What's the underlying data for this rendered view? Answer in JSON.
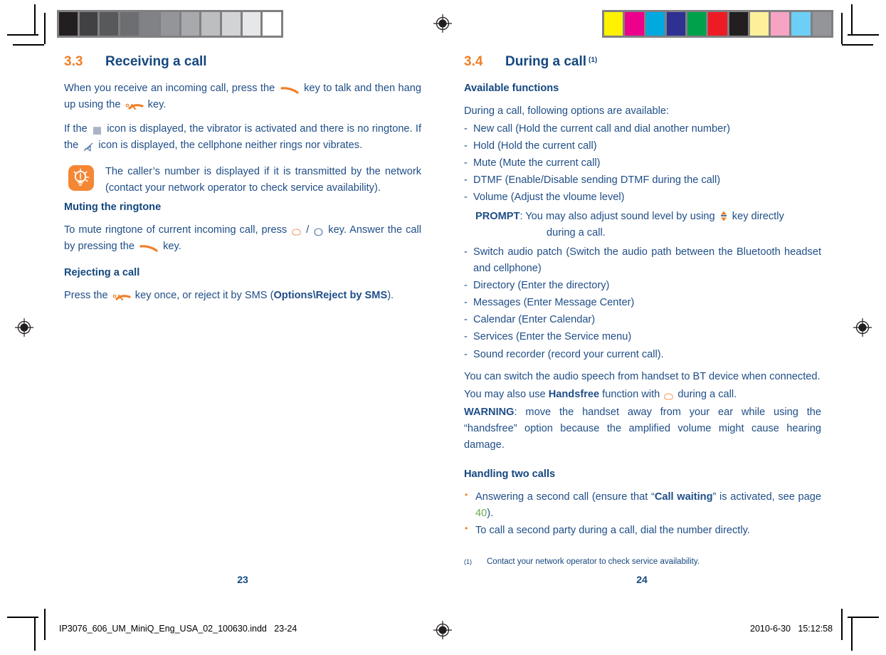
{
  "document": {
    "imprint_left": "IP3076_606_UM_MiniQ_Eng_USA_02_100630.indd   23-24",
    "imprint_right": "2010-6-30   15:12:58"
  },
  "calibration": {
    "grayscale_label": "grayscale-calibration-strip",
    "grayscale_swatches": [
      "#231f20",
      "#414042",
      "#58595b",
      "#6d6e71",
      "#808285",
      "#939598",
      "#a7a9ac",
      "#bcbec0",
      "#d1d3d4",
      "#e6e7e8",
      "#ffffff"
    ],
    "color_label": "color-calibration-strip",
    "color_swatches": [
      "#fff200",
      "#ec008c",
      "#00a9e0",
      "#2e3192",
      "#00a14b",
      "#ed1c24",
      "#231f20",
      "#fdf09a",
      "#f6a3c4",
      "#6dcff6",
      "#939598"
    ]
  },
  "left_page": {
    "section_number": "3.3",
    "section_title": "Receiving a call",
    "para_1_a": "When you receive an incoming call, press the",
    "para_1_b": "key to talk and then hang up using the",
    "para_1_c": "key.",
    "para_2_a": "If the",
    "para_2_b": "icon is displayed, the vibrator is activated and there is no ringtone. If the",
    "para_2_c": "icon is displayed, the cellphone neither rings nor vibrates.",
    "tip_text": "The caller’s number is displayed if it is transmitted by the network (contact your network operator to check service availability).",
    "subtitle_mute": "Muting the ringtone",
    "mute_a": "To mute ringtone of current incoming call, press",
    "mute_slash": "/",
    "mute_b": "key. Answer the call by pressing the",
    "mute_c": "key.",
    "subtitle_reject": "Rejecting a call",
    "reject_a": "Press the",
    "reject_b": "key once, or reject it by SMS (",
    "reject_bold": "Options\\Reject by SMS",
    "reject_c": ").",
    "page_number": "23"
  },
  "right_page": {
    "section_number": "3.4",
    "section_title": "During a call",
    "section_footnote_mark": "(1)",
    "subtitle_available": "Available functions",
    "intro": "During a call, following options are available:",
    "options": [
      "New call (Hold the current call and dial another number)",
      "Hold (Hold the current call)",
      "Mute (Mute the current call)",
      "DTMF (Enable/Disable sending DTMF during the call)",
      "Volume (Adjust the vloume level)"
    ],
    "prompt_label": "PROMPT",
    "prompt_a": ": You may also adjust sound level by using",
    "prompt_b": "key directly",
    "prompt_c": "during a call.",
    "options2": [
      "Switch audio patch (Switch the audio path between the Bluetooth headset and cellphone)",
      "Directory (Enter the directory)",
      "Messages (Enter Message Center)",
      "Calendar (Enter Calendar)",
      "Services (Enter the Service menu)",
      "Sound recorder (record your current call)."
    ],
    "switch_para": "You can switch the audio speech from handset to BT device when connected.",
    "handsfree_a": "You may also use",
    "handsfree_bold": "Handsfree",
    "handsfree_b": "function with",
    "handsfree_c": "during a call.",
    "warning_label": "WARNING",
    "warning_text": ": move the handset away from your ear while using the “handsfree” option because the amplified volume might cause hearing damage.",
    "subtitle_handling": "Handling two calls",
    "bullet_1_a": "Answering a second call (ensure that “",
    "bullet_1_bold": "Call waiting",
    "bullet_1_b": "” is activated, see page",
    "bullet_1_page_ref": "40",
    "bullet_1_c": ").",
    "bullet_2": "To call a second party during a call, dial the number directly.",
    "footnote_mark": "(1)",
    "footnote_text": "Contact your network operator to check service availability.",
    "page_number": "24"
  },
  "colors": {
    "body_blue": "#1f4e87",
    "heading_blue": "#14477f",
    "accent_orange": "#f07f28",
    "tip_orange": "#f58634",
    "page_ref_green": "#6aa84f"
  }
}
